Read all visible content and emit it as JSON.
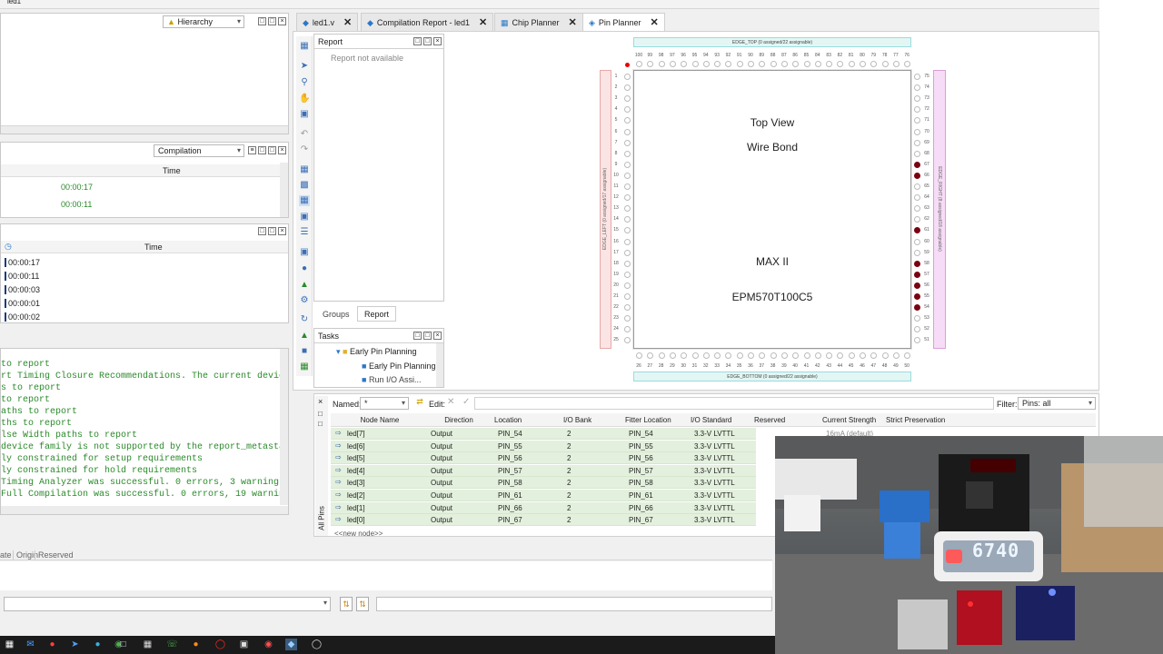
{
  "window": {
    "top_title": "led1"
  },
  "left": {
    "hierarchy_dropdown": "Hierarchy",
    "compilation_dropdown": "Compilation",
    "time_header": "Time",
    "compile_times": [
      "00:00:17",
      "00:00:11"
    ],
    "flow_time_header": "Time",
    "flow_times": [
      "00:00:17",
      "00:00:11",
      "00:00:03",
      "00:00:01",
      "00:00:02"
    ],
    "messages": [
      " to report",
      "rt Timing Closure Recommendations. The current device",
      "s to report",
      " to report",
      "aths to report",
      "ths to report",
      "lse Width paths to report",
      "device family is not supported by the report_metastabi",
      "ly constrained for setup requirements",
      "ly constrained for hold requirements",
      " Timing Analyzer was successful. 0 errors, 3 warnings",
      " Full Compilation was successful. 0 errors, 19 warning"
    ],
    "bottom_tabs": [
      "ate",
      "Origin",
      "Reserved"
    ]
  },
  "tabs": [
    {
      "label": "led1.v",
      "icon": "verilog-file-icon"
    },
    {
      "label": "Compilation Report - led1",
      "icon": "report-icon"
    },
    {
      "label": "Chip Planner",
      "icon": "chip-icon"
    },
    {
      "label": "Pin Planner",
      "icon": "pin-icon"
    }
  ],
  "report_panel": {
    "title": "Report",
    "message": "Report not available",
    "tabs": [
      "Groups",
      "Report"
    ]
  },
  "tasks_panel": {
    "title": "Tasks",
    "items": [
      "Early Pin Planning",
      "Early Pin Planning",
      "Run I/O Assi..."
    ]
  },
  "chip": {
    "view_title": "Top View",
    "bond": "Wire Bond",
    "family": "MAX II",
    "part": "EPM570T100C5",
    "edge_top": "EDGE_TOP (0 assigned/22 assignable)",
    "edge_bottom": "EDGE_BOTTOM (0 assigned/22 assignable)",
    "edge_left": "EDGE_LEFT (0 assigned/17 assignable)",
    "edge_right": "EDGE_RIGHT (8 assigned/18 assignable)",
    "top_pins": [
      "100",
      "99",
      "98",
      "97",
      "96",
      "95",
      "94",
      "93",
      "92",
      "91",
      "90",
      "89",
      "88",
      "87",
      "86",
      "85",
      "84",
      "83",
      "82",
      "81",
      "80",
      "79",
      "78",
      "77",
      "76"
    ],
    "bottom_pins": [
      "26",
      "27",
      "28",
      "29",
      "30",
      "31",
      "32",
      "33",
      "34",
      "35",
      "36",
      "37",
      "38",
      "39",
      "40",
      "41",
      "42",
      "43",
      "44",
      "45",
      "46",
      "47",
      "48",
      "49",
      "50"
    ],
    "left_pins": [
      "1",
      "2",
      "3",
      "4",
      "5",
      "6",
      "7",
      "8",
      "9",
      "10",
      "11",
      "12",
      "13",
      "14",
      "15",
      "16",
      "17",
      "18",
      "19",
      "20",
      "21",
      "22",
      "23",
      "24",
      "25"
    ],
    "right_pins": [
      "75",
      "74",
      "73",
      "72",
      "71",
      "70",
      "69",
      "68",
      "67",
      "66",
      "65",
      "64",
      "63",
      "62",
      "61",
      "60",
      "59",
      "58",
      "57",
      "56",
      "55",
      "54",
      "53",
      "52",
      "51"
    ],
    "right_assigned": [
      "67",
      "66",
      "61",
      "58",
      "57",
      "56",
      "55",
      "54"
    ]
  },
  "pin_table": {
    "named_label": "Named:",
    "named_value": "*",
    "edit_label": "Edit:",
    "filter_label": "Filter:",
    "filter_value": "Pins: all",
    "side_label": "All Pins",
    "columns": [
      "Node Name",
      "Direction",
      "Location",
      "I/O Bank",
      "Fitter Location",
      "I/O Standard",
      "Reserved",
      "Current Strength",
      "Strict Preservation"
    ],
    "rows": [
      [
        "led[7]",
        "Output",
        "PIN_54",
        "2",
        "PIN_54",
        "3.3-V LVTTL",
        "",
        "16mA (default)",
        ""
      ],
      [
        "led[6]",
        "Output",
        "PIN_55",
        "2",
        "PIN_55",
        "3.3-V LVTTL",
        "",
        "",
        ""
      ],
      [
        "led[5]",
        "Output",
        "PIN_56",
        "2",
        "PIN_56",
        "3.3-V LVTTL",
        "",
        "",
        ""
      ],
      [
        "led[4]",
        "Output",
        "PIN_57",
        "2",
        "PIN_57",
        "3.3-V LVTTL",
        "",
        "",
        ""
      ],
      [
        "led[3]",
        "Output",
        "PIN_58",
        "2",
        "PIN_58",
        "3.3-V LVTTL",
        "",
        "",
        ""
      ],
      [
        "led[2]",
        "Output",
        "PIN_61",
        "2",
        "PIN_61",
        "3.3-V LVTTL",
        "",
        "",
        ""
      ],
      [
        "led[1]",
        "Output",
        "PIN_66",
        "2",
        "PIN_66",
        "3.3-V LVTTL",
        "",
        "",
        ""
      ],
      [
        "led[0]",
        "Output",
        "PIN_67",
        "2",
        "PIN_67",
        "3.3-V LVTTL",
        "",
        "",
        ""
      ]
    ],
    "new_node": "<<new node>>"
  },
  "webcam": {
    "display_value": "6740"
  },
  "colors": {
    "assigned_pin": "#7a0010",
    "row_bg": "#e3f0dd",
    "msg_green": "#2a8a2a"
  }
}
